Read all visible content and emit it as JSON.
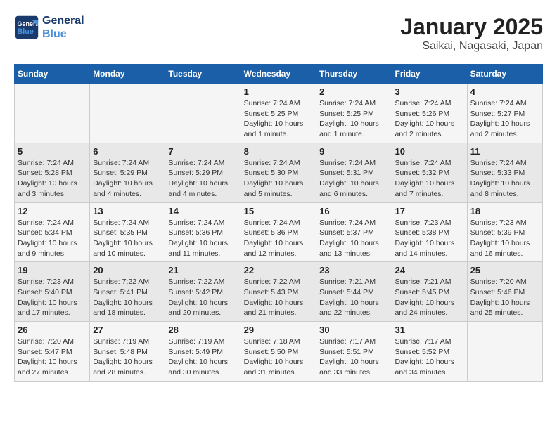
{
  "header": {
    "logo_line1": "General",
    "logo_line2": "Blue",
    "title": "January 2025",
    "subtitle": "Saikai, Nagasaki, Japan"
  },
  "weekdays": [
    "Sunday",
    "Monday",
    "Tuesday",
    "Wednesday",
    "Thursday",
    "Friday",
    "Saturday"
  ],
  "weeks": [
    [
      {
        "day": "",
        "info": ""
      },
      {
        "day": "",
        "info": ""
      },
      {
        "day": "",
        "info": ""
      },
      {
        "day": "1",
        "info": "Sunrise: 7:24 AM\nSunset: 5:25 PM\nDaylight: 10 hours\nand 1 minute."
      },
      {
        "day": "2",
        "info": "Sunrise: 7:24 AM\nSunset: 5:25 PM\nDaylight: 10 hours\nand 1 minute."
      },
      {
        "day": "3",
        "info": "Sunrise: 7:24 AM\nSunset: 5:26 PM\nDaylight: 10 hours\nand 2 minutes."
      },
      {
        "day": "4",
        "info": "Sunrise: 7:24 AM\nSunset: 5:27 PM\nDaylight: 10 hours\nand 2 minutes."
      }
    ],
    [
      {
        "day": "5",
        "info": "Sunrise: 7:24 AM\nSunset: 5:28 PM\nDaylight: 10 hours\nand 3 minutes."
      },
      {
        "day": "6",
        "info": "Sunrise: 7:24 AM\nSunset: 5:29 PM\nDaylight: 10 hours\nand 4 minutes."
      },
      {
        "day": "7",
        "info": "Sunrise: 7:24 AM\nSunset: 5:29 PM\nDaylight: 10 hours\nand 4 minutes."
      },
      {
        "day": "8",
        "info": "Sunrise: 7:24 AM\nSunset: 5:30 PM\nDaylight: 10 hours\nand 5 minutes."
      },
      {
        "day": "9",
        "info": "Sunrise: 7:24 AM\nSunset: 5:31 PM\nDaylight: 10 hours\nand 6 minutes."
      },
      {
        "day": "10",
        "info": "Sunrise: 7:24 AM\nSunset: 5:32 PM\nDaylight: 10 hours\nand 7 minutes."
      },
      {
        "day": "11",
        "info": "Sunrise: 7:24 AM\nSunset: 5:33 PM\nDaylight: 10 hours\nand 8 minutes."
      }
    ],
    [
      {
        "day": "12",
        "info": "Sunrise: 7:24 AM\nSunset: 5:34 PM\nDaylight: 10 hours\nand 9 minutes."
      },
      {
        "day": "13",
        "info": "Sunrise: 7:24 AM\nSunset: 5:35 PM\nDaylight: 10 hours\nand 10 minutes."
      },
      {
        "day": "14",
        "info": "Sunrise: 7:24 AM\nSunset: 5:36 PM\nDaylight: 10 hours\nand 11 minutes."
      },
      {
        "day": "15",
        "info": "Sunrise: 7:24 AM\nSunset: 5:36 PM\nDaylight: 10 hours\nand 12 minutes."
      },
      {
        "day": "16",
        "info": "Sunrise: 7:24 AM\nSunset: 5:37 PM\nDaylight: 10 hours\nand 13 minutes."
      },
      {
        "day": "17",
        "info": "Sunrise: 7:23 AM\nSunset: 5:38 PM\nDaylight: 10 hours\nand 14 minutes."
      },
      {
        "day": "18",
        "info": "Sunrise: 7:23 AM\nSunset: 5:39 PM\nDaylight: 10 hours\nand 16 minutes."
      }
    ],
    [
      {
        "day": "19",
        "info": "Sunrise: 7:23 AM\nSunset: 5:40 PM\nDaylight: 10 hours\nand 17 minutes."
      },
      {
        "day": "20",
        "info": "Sunrise: 7:22 AM\nSunset: 5:41 PM\nDaylight: 10 hours\nand 18 minutes."
      },
      {
        "day": "21",
        "info": "Sunrise: 7:22 AM\nSunset: 5:42 PM\nDaylight: 10 hours\nand 20 minutes."
      },
      {
        "day": "22",
        "info": "Sunrise: 7:22 AM\nSunset: 5:43 PM\nDaylight: 10 hours\nand 21 minutes."
      },
      {
        "day": "23",
        "info": "Sunrise: 7:21 AM\nSunset: 5:44 PM\nDaylight: 10 hours\nand 22 minutes."
      },
      {
        "day": "24",
        "info": "Sunrise: 7:21 AM\nSunset: 5:45 PM\nDaylight: 10 hours\nand 24 minutes."
      },
      {
        "day": "25",
        "info": "Sunrise: 7:20 AM\nSunset: 5:46 PM\nDaylight: 10 hours\nand 25 minutes."
      }
    ],
    [
      {
        "day": "26",
        "info": "Sunrise: 7:20 AM\nSunset: 5:47 PM\nDaylight: 10 hours\nand 27 minutes."
      },
      {
        "day": "27",
        "info": "Sunrise: 7:19 AM\nSunset: 5:48 PM\nDaylight: 10 hours\nand 28 minutes."
      },
      {
        "day": "28",
        "info": "Sunrise: 7:19 AM\nSunset: 5:49 PM\nDaylight: 10 hours\nand 30 minutes."
      },
      {
        "day": "29",
        "info": "Sunrise: 7:18 AM\nSunset: 5:50 PM\nDaylight: 10 hours\nand 31 minutes."
      },
      {
        "day": "30",
        "info": "Sunrise: 7:17 AM\nSunset: 5:51 PM\nDaylight: 10 hours\nand 33 minutes."
      },
      {
        "day": "31",
        "info": "Sunrise: 7:17 AM\nSunset: 5:52 PM\nDaylight: 10 hours\nand 34 minutes."
      },
      {
        "day": "",
        "info": ""
      }
    ]
  ]
}
